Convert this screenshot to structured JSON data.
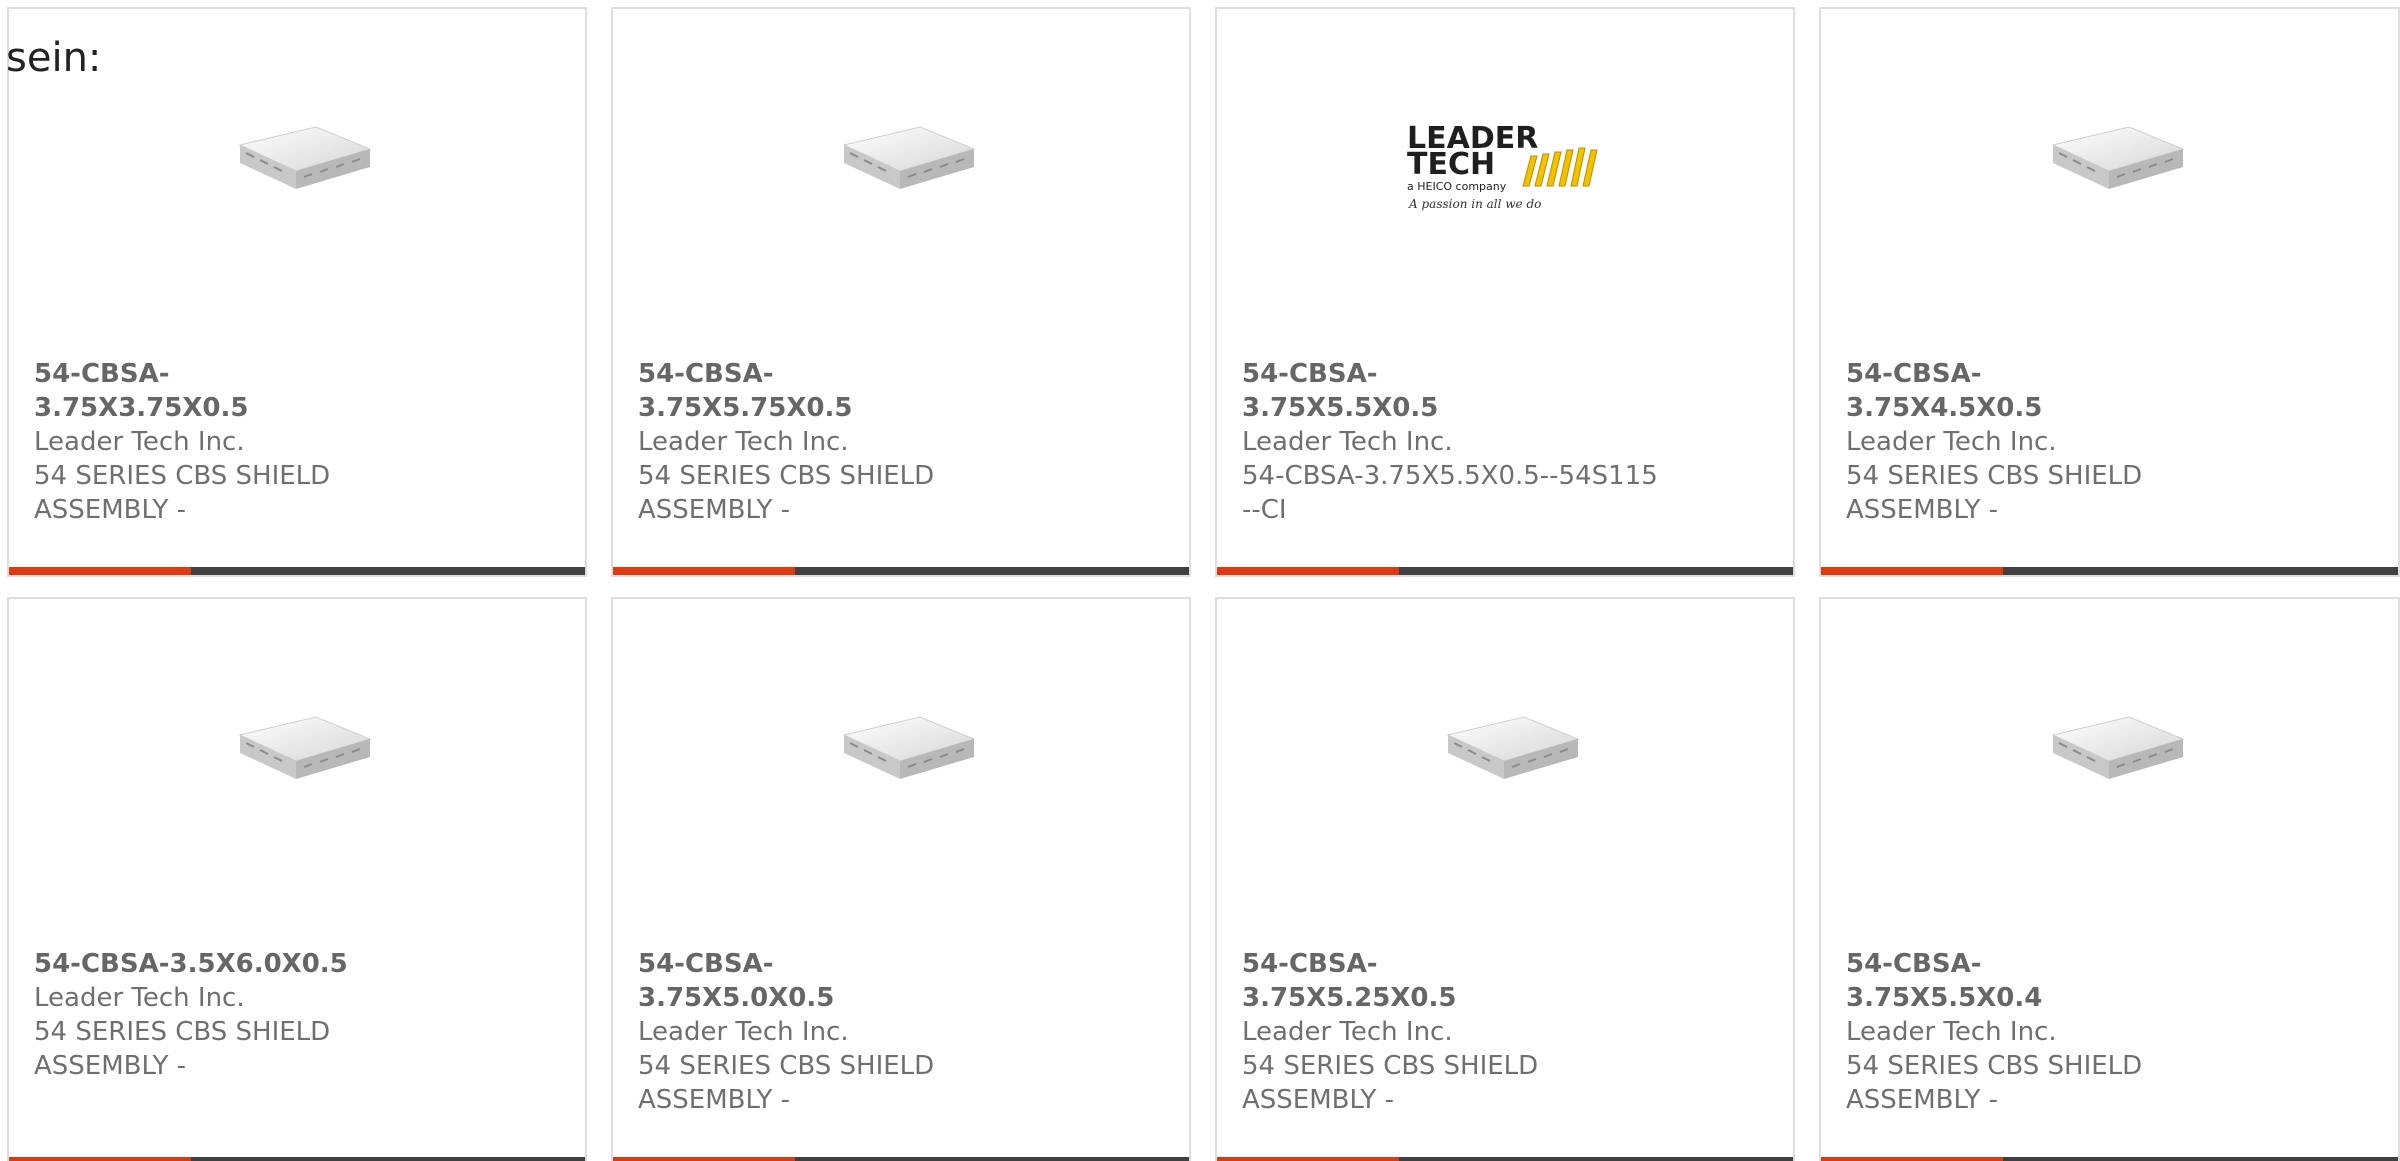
{
  "intro_text": "sein:",
  "accent_color": "#de3a12",
  "bar_color": "#404040",
  "products": [
    {
      "part": "54-CBSA-3.75X3.75X0.5",
      "maker": "Leader Tech Inc.",
      "description": "54 SERIES CBS SHIELD ASSEMBLY -",
      "image": "shield-product-image"
    },
    {
      "part": "54-CBSA-3.75X5.75X0.5",
      "maker": "Leader Tech Inc.",
      "description": "54 SERIES CBS SHIELD ASSEMBLY -",
      "image": "shield-product-image"
    },
    {
      "part": "54-CBSA-3.75X5.5X0.5",
      "maker": "Leader Tech Inc.",
      "description": "54-CBSA-3.75X5.5X0.5--54S115--CI",
      "image": "leader-tech-logo",
      "logo_text": [
        "LEADER",
        "TECH",
        "a HEICO company",
        "A passion in all we do"
      ]
    },
    {
      "part": "54-CBSA-3.75X4.5X0.5",
      "maker": "Leader Tech Inc.",
      "description": "54 SERIES CBS SHIELD ASSEMBLY -",
      "image": "shield-product-image"
    },
    {
      "part": "54-CBSA-3.5X6.0X0.5",
      "maker": "Leader Tech Inc.",
      "description": "54 SERIES CBS SHIELD ASSEMBLY -",
      "image": "shield-product-image"
    },
    {
      "part": "54-CBSA-3.75X5.0X0.5",
      "maker": "Leader Tech Inc.",
      "description": "54 SERIES CBS SHIELD ASSEMBLY -",
      "image": "shield-product-image"
    },
    {
      "part": "54-CBSA-3.75X5.25X0.5",
      "maker": "Leader Tech Inc.",
      "description": "54 SERIES CBS SHIELD ASSEMBLY -",
      "image": "shield-product-image"
    },
    {
      "part": "54-CBSA-3.75X5.5X0.4",
      "maker": "Leader Tech Inc.",
      "description": "54 SERIES CBS SHIELD ASSEMBLY -",
      "image": "shield-product-image"
    }
  ]
}
